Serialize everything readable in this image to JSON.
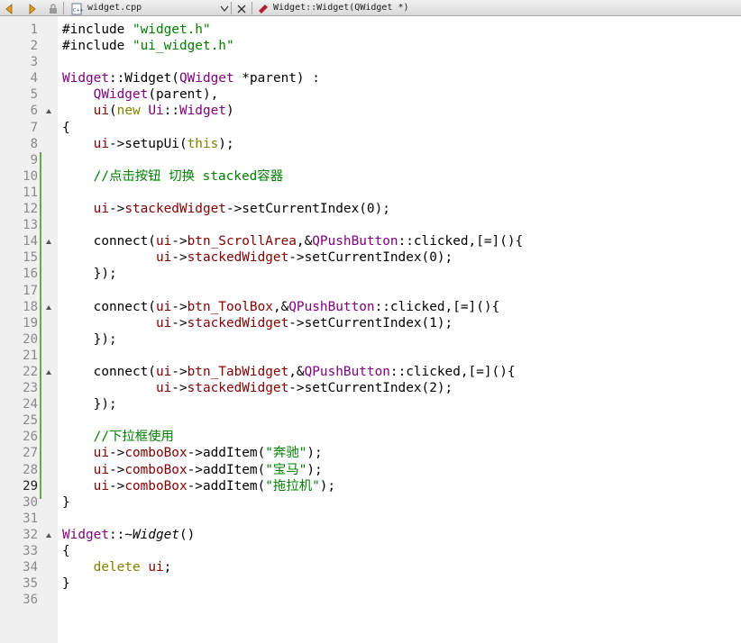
{
  "toolbar": {
    "file_name": "widget.cpp",
    "symbol": "Widget::Widget(QWidget *)",
    "icons": [
      "back-arrow-icon",
      "forward-arrow-icon",
      "lock-icon",
      "cpp-file-icon",
      "split-icon",
      "close-icon",
      "function-icon"
    ]
  },
  "colors": {
    "keyword": "#808000",
    "string": "#008000",
    "type": "#800080",
    "member": "#800000",
    "comment": "#008000",
    "change_marker": "#6aa84f",
    "gutter_bg": "#f0f0f0"
  },
  "editor": {
    "current_line": 29,
    "lines": [
      {
        "n": "1",
        "fold": false,
        "tokens": [
          {
            "t": "#include ",
            "c": "def"
          },
          {
            "t": "\"widget.h\"",
            "c": "str"
          }
        ]
      },
      {
        "n": "2",
        "fold": false,
        "tokens": [
          {
            "t": "#include ",
            "c": "def"
          },
          {
            "t": "\"ui_widget.h\"",
            "c": "str"
          }
        ]
      },
      {
        "n": "3",
        "fold": false,
        "tokens": []
      },
      {
        "n": "4",
        "fold": false,
        "tokens": [
          {
            "t": "Widget",
            "c": "type"
          },
          {
            "t": "::Widget(",
            "c": "def"
          },
          {
            "t": "QWidget",
            "c": "type"
          },
          {
            "t": " *parent) :",
            "c": "def"
          }
        ]
      },
      {
        "n": "5",
        "fold": false,
        "tokens": [
          {
            "t": "    ",
            "c": "def"
          },
          {
            "t": "QWidget",
            "c": "type"
          },
          {
            "t": "(parent),",
            "c": "def"
          }
        ]
      },
      {
        "n": "6",
        "fold": true,
        "tokens": [
          {
            "t": "    ",
            "c": "def"
          },
          {
            "t": "ui",
            "c": "mem"
          },
          {
            "t": "(",
            "c": "def"
          },
          {
            "t": "new",
            "c": "kw"
          },
          {
            "t": " ",
            "c": "def"
          },
          {
            "t": "Ui",
            "c": "type"
          },
          {
            "t": "::",
            "c": "def"
          },
          {
            "t": "Widget",
            "c": "type"
          },
          {
            "t": ")",
            "c": "def"
          }
        ]
      },
      {
        "n": "7",
        "fold": false,
        "tokens": [
          {
            "t": "{",
            "c": "def"
          }
        ]
      },
      {
        "n": "8",
        "fold": false,
        "tokens": [
          {
            "t": "    ",
            "c": "def"
          },
          {
            "t": "ui",
            "c": "mem"
          },
          {
            "t": "->setupUi(",
            "c": "def"
          },
          {
            "t": "this",
            "c": "kw"
          },
          {
            "t": ");",
            "c": "def"
          }
        ]
      },
      {
        "n": "9",
        "fold": false,
        "tokens": []
      },
      {
        "n": "10",
        "fold": false,
        "tokens": [
          {
            "t": "    //点击按钮 切换 stacked容器",
            "c": "com"
          }
        ]
      },
      {
        "n": "11",
        "fold": false,
        "tokens": []
      },
      {
        "n": "12",
        "fold": false,
        "tokens": [
          {
            "t": "    ",
            "c": "def"
          },
          {
            "t": "ui",
            "c": "mem"
          },
          {
            "t": "->",
            "c": "def"
          },
          {
            "t": "stackedWidget",
            "c": "mem"
          },
          {
            "t": "->setCurrentIndex(0);",
            "c": "def"
          }
        ]
      },
      {
        "n": "13",
        "fold": false,
        "tokens": []
      },
      {
        "n": "14",
        "fold": true,
        "tokens": [
          {
            "t": "    connect(",
            "c": "def"
          },
          {
            "t": "ui",
            "c": "mem"
          },
          {
            "t": "->",
            "c": "def"
          },
          {
            "t": "btn_ScrollArea",
            "c": "mem"
          },
          {
            "t": ",&",
            "c": "def"
          },
          {
            "t": "QPushButton",
            "c": "type"
          },
          {
            "t": "::clicked,[=](){",
            "c": "def"
          }
        ]
      },
      {
        "n": "15",
        "fold": false,
        "tokens": [
          {
            "t": "            ",
            "c": "def"
          },
          {
            "t": "ui",
            "c": "mem"
          },
          {
            "t": "->",
            "c": "def"
          },
          {
            "t": "stackedWidget",
            "c": "mem"
          },
          {
            "t": "->setCurrentIndex(0);",
            "c": "def"
          }
        ]
      },
      {
        "n": "16",
        "fold": false,
        "tokens": [
          {
            "t": "    });",
            "c": "def"
          }
        ]
      },
      {
        "n": "17",
        "fold": false,
        "tokens": []
      },
      {
        "n": "18",
        "fold": true,
        "tokens": [
          {
            "t": "    connect(",
            "c": "def"
          },
          {
            "t": "ui",
            "c": "mem"
          },
          {
            "t": "->",
            "c": "def"
          },
          {
            "t": "btn_ToolBox",
            "c": "mem"
          },
          {
            "t": ",&",
            "c": "def"
          },
          {
            "t": "QPushButton",
            "c": "type"
          },
          {
            "t": "::clicked,[=](){",
            "c": "def"
          }
        ]
      },
      {
        "n": "19",
        "fold": false,
        "tokens": [
          {
            "t": "            ",
            "c": "def"
          },
          {
            "t": "ui",
            "c": "mem"
          },
          {
            "t": "->",
            "c": "def"
          },
          {
            "t": "stackedWidget",
            "c": "mem"
          },
          {
            "t": "->setCurrentIndex(1);",
            "c": "def"
          }
        ]
      },
      {
        "n": "20",
        "fold": false,
        "tokens": [
          {
            "t": "    });",
            "c": "def"
          }
        ]
      },
      {
        "n": "21",
        "fold": false,
        "tokens": []
      },
      {
        "n": "22",
        "fold": true,
        "tokens": [
          {
            "t": "    connect(",
            "c": "def"
          },
          {
            "t": "ui",
            "c": "mem"
          },
          {
            "t": "->",
            "c": "def"
          },
          {
            "t": "btn_TabWidget",
            "c": "mem"
          },
          {
            "t": ",&",
            "c": "def"
          },
          {
            "t": "QPushButton",
            "c": "type"
          },
          {
            "t": "::clicked,[=](){",
            "c": "def"
          }
        ]
      },
      {
        "n": "23",
        "fold": false,
        "tokens": [
          {
            "t": "            ",
            "c": "def"
          },
          {
            "t": "ui",
            "c": "mem"
          },
          {
            "t": "->",
            "c": "def"
          },
          {
            "t": "stackedWidget",
            "c": "mem"
          },
          {
            "t": "->setCurrentIndex(2);",
            "c": "def"
          }
        ]
      },
      {
        "n": "24",
        "fold": false,
        "tokens": [
          {
            "t": "    });",
            "c": "def"
          }
        ]
      },
      {
        "n": "25",
        "fold": false,
        "tokens": []
      },
      {
        "n": "26",
        "fold": false,
        "tokens": [
          {
            "t": "    //下拉框使用",
            "c": "com"
          }
        ]
      },
      {
        "n": "27",
        "fold": false,
        "tokens": [
          {
            "t": "    ",
            "c": "def"
          },
          {
            "t": "ui",
            "c": "mem"
          },
          {
            "t": "->",
            "c": "def"
          },
          {
            "t": "comboBox",
            "c": "mem"
          },
          {
            "t": "->addItem(",
            "c": "def"
          },
          {
            "t": "\"奔驰\"",
            "c": "str"
          },
          {
            "t": ");",
            "c": "def"
          }
        ]
      },
      {
        "n": "28",
        "fold": false,
        "tokens": [
          {
            "t": "    ",
            "c": "def"
          },
          {
            "t": "ui",
            "c": "mem"
          },
          {
            "t": "->",
            "c": "def"
          },
          {
            "t": "comboBox",
            "c": "mem"
          },
          {
            "t": "->addItem(",
            "c": "def"
          },
          {
            "t": "\"宝马\"",
            "c": "str"
          },
          {
            "t": ");",
            "c": "def"
          }
        ]
      },
      {
        "n": "29",
        "fold": false,
        "tokens": [
          {
            "t": "    ",
            "c": "def"
          },
          {
            "t": "ui",
            "c": "mem"
          },
          {
            "t": "->",
            "c": "def"
          },
          {
            "t": "comboBox",
            "c": "mem"
          },
          {
            "t": "->addItem(",
            "c": "def"
          },
          {
            "t": "\"拖拉机\"",
            "c": "str"
          },
          {
            "t": ");",
            "c": "def"
          }
        ]
      },
      {
        "n": "30",
        "fold": false,
        "tokens": [
          {
            "t": "}",
            "c": "def"
          }
        ]
      },
      {
        "n": "31",
        "fold": false,
        "tokens": []
      },
      {
        "n": "32",
        "fold": true,
        "tokens": [
          {
            "t": "Widget",
            "c": "type"
          },
          {
            "t": "::~",
            "c": "def"
          },
          {
            "t": "Widget",
            "c": "ital"
          },
          {
            "t": "()",
            "c": "def"
          }
        ]
      },
      {
        "n": "33",
        "fold": false,
        "tokens": [
          {
            "t": "{",
            "c": "def"
          }
        ]
      },
      {
        "n": "34",
        "fold": false,
        "tokens": [
          {
            "t": "    ",
            "c": "def"
          },
          {
            "t": "delete",
            "c": "kw"
          },
          {
            "t": " ",
            "c": "def"
          },
          {
            "t": "ui",
            "c": "mem"
          },
          {
            "t": ";",
            "c": "def"
          }
        ]
      },
      {
        "n": "35",
        "fold": false,
        "tokens": [
          {
            "t": "}",
            "c": "def"
          }
        ]
      },
      {
        "n": "36",
        "fold": false,
        "tokens": []
      }
    ]
  }
}
